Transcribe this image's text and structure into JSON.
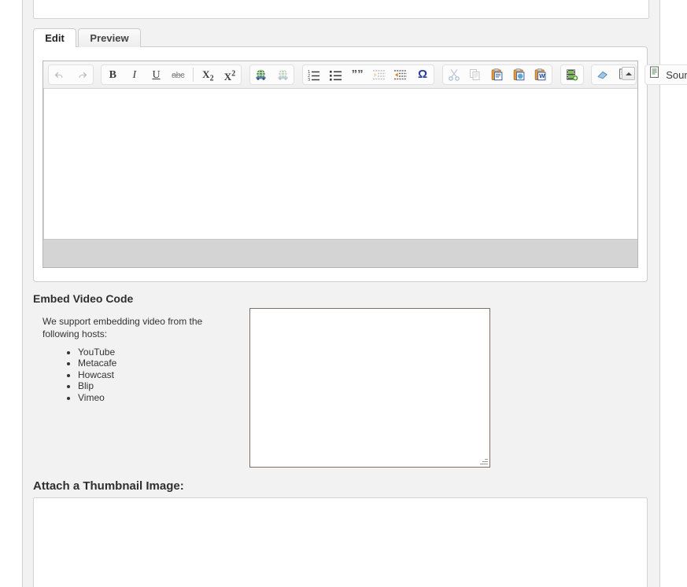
{
  "tabs": [
    {
      "label": "Edit",
      "active": true
    },
    {
      "label": "Preview",
      "active": false
    }
  ],
  "editor": {
    "toolbar_groups": [
      {
        "name": "history",
        "buttons": [
          {
            "name": "undo-icon",
            "label": ""
          },
          {
            "name": "redo-icon",
            "label": ""
          }
        ]
      },
      {
        "name": "basic-styles",
        "buttons": [
          {
            "name": "bold-icon",
            "label": "B"
          },
          {
            "name": "italic-icon",
            "label": "I"
          },
          {
            "name": "underline-icon",
            "label": "U"
          },
          {
            "name": "strikethrough-icon",
            "label": "abc"
          },
          {
            "name": "subscript-icon",
            "label": "X2"
          },
          {
            "name": "superscript-icon",
            "label": "X2"
          }
        ]
      },
      {
        "name": "links",
        "buttons": [
          {
            "name": "link-icon",
            "label": ""
          },
          {
            "name": "unlink-icon",
            "label": ""
          }
        ]
      },
      {
        "name": "paragraph",
        "buttons": [
          {
            "name": "numbered-list-icon",
            "label": ""
          },
          {
            "name": "bulleted-list-icon",
            "label": ""
          },
          {
            "name": "blockquote-icon",
            "label": "””"
          },
          {
            "name": "outdent-icon",
            "label": ""
          },
          {
            "name": "indent-icon",
            "label": ""
          },
          {
            "name": "special-character-icon",
            "label": "Ω"
          }
        ]
      },
      {
        "name": "clipboard",
        "buttons": [
          {
            "name": "cut-icon",
            "label": ""
          },
          {
            "name": "copy-icon",
            "label": ""
          },
          {
            "name": "paste-icon",
            "label": ""
          },
          {
            "name": "paste-text-icon",
            "label": ""
          },
          {
            "name": "paste-from-word-icon",
            "label": ""
          }
        ]
      },
      {
        "name": "media",
        "buttons": [
          {
            "name": "media-embed-icon",
            "label": ""
          }
        ]
      },
      {
        "name": "tools",
        "buttons": [
          {
            "name": "remove-format-icon",
            "label": ""
          },
          {
            "name": "spell-check-icon",
            "label": ""
          }
        ]
      }
    ],
    "source_button_label": "Source",
    "content": ""
  },
  "embed_video": {
    "heading": "Embed Video Code",
    "description": "We support embedding video from the following hosts:",
    "hosts": [
      "YouTube",
      "Metacafe",
      "Howcast",
      "Blip",
      "Vimeo"
    ],
    "textarea_value": "",
    "textarea_placeholder": ""
  },
  "thumbnail": {
    "heading": "Attach a Thumbnail Image:"
  },
  "colors": {
    "page_background": "#f2f2f2",
    "panel_background": "#ffffff",
    "panel_border": "#cccccc",
    "editor_footer": "#d4d4d4",
    "textarea_border": "#7d6f63",
    "heading_text": "#2f2f2f",
    "omega_accent": "#2a3f9d"
  }
}
